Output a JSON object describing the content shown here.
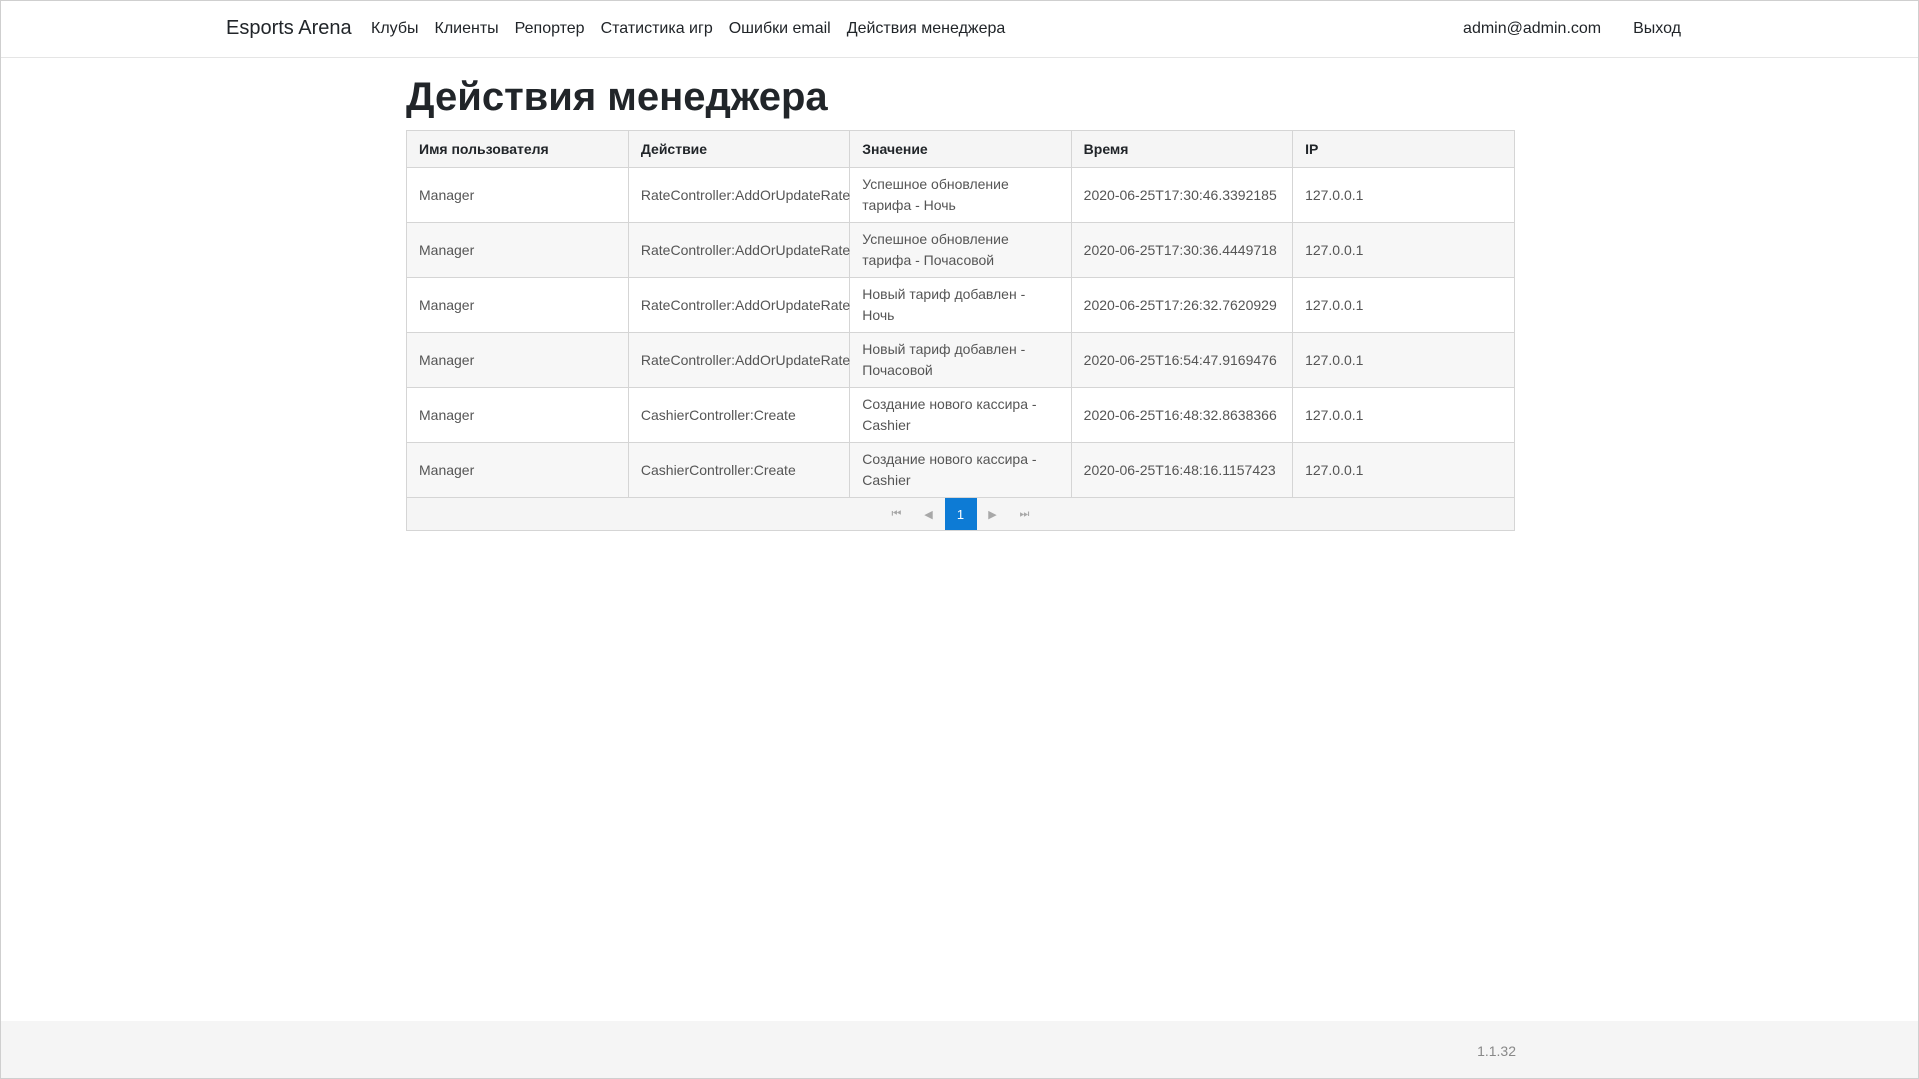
{
  "navbar": {
    "brand": "Esports Arena",
    "links": [
      "Клубы",
      "Клиенты",
      "Репортер",
      "Статистика игр",
      "Ошибки email",
      "Действия менеджера"
    ],
    "user_email": "admin@admin.com",
    "logout": "Выход"
  },
  "page": {
    "title": "Действия менеджера"
  },
  "table": {
    "columns": [
      "Имя пользователя",
      "Действие",
      "Значение",
      "Время",
      "IP"
    ],
    "rows": [
      [
        "Manager",
        "RateController:AddOrUpdateRate",
        "Успешное обновление тарифа - Ночь",
        "2020-06-25T17:30:46.3392185",
        "127.0.0.1"
      ],
      [
        "Manager",
        "RateController:AddOrUpdateRate",
        "Успешное обновление тарифа - Почасовой",
        "2020-06-25T17:30:36.4449718",
        "127.0.0.1"
      ],
      [
        "Manager",
        "RateController:AddOrUpdateRate",
        "Новый тариф добавлен - Ночь",
        "2020-06-25T17:26:32.7620929",
        "127.0.0.1"
      ],
      [
        "Manager",
        "RateController:AddOrUpdateRate",
        "Новый тариф добавлен - Почасовой",
        "2020-06-25T16:54:47.9169476",
        "127.0.0.1"
      ],
      [
        "Manager",
        "CashierController:Create",
        "Создание нового кассира - Cashier",
        "2020-06-25T16:48:32.8638366",
        "127.0.0.1"
      ],
      [
        "Manager",
        "CashierController:Create",
        "Создание нового кассира - Cashier",
        "2020-06-25T16:48:16.1157423",
        "127.0.0.1"
      ]
    ]
  },
  "pager": {
    "current_page": "1",
    "icons": {
      "first": "first-page-icon",
      "prev": "previous-page-icon",
      "next": "next-page-icon",
      "last": "last-page-icon"
    }
  },
  "footer": {
    "version": "1.1.32"
  },
  "colors": {
    "accent": "#0d7bd5",
    "header_bg": "#f5f5f5",
    "border": "#d5d5d5"
  }
}
